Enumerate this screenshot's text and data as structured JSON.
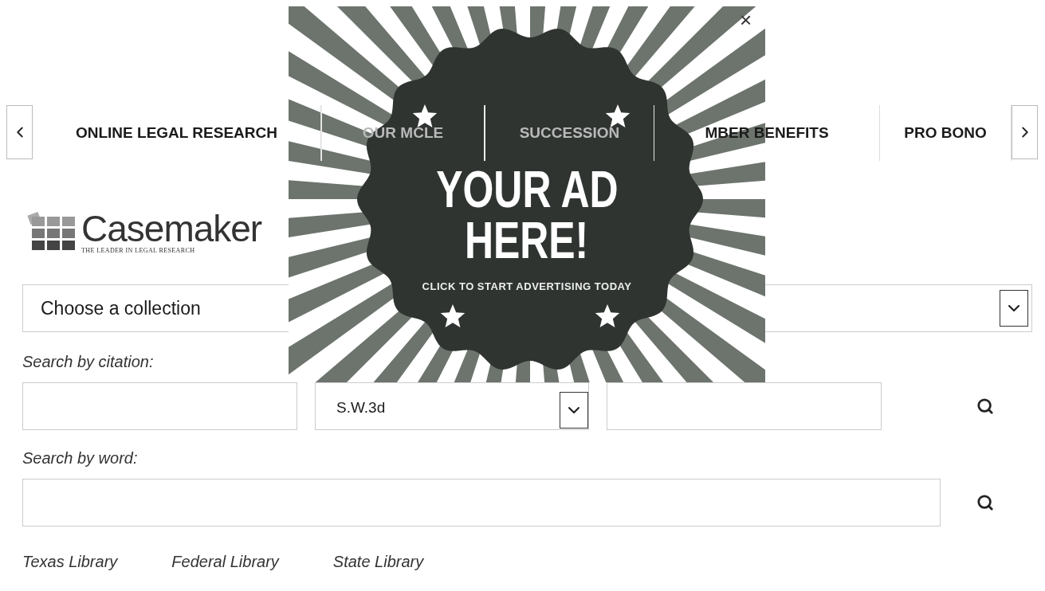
{
  "nav": {
    "tabs": [
      {
        "label": "ONLINE LEGAL RESEARCH",
        "dimmed": false
      },
      {
        "label": "OUR MCLE",
        "dimmed": true
      },
      {
        "label": "SUCCESSION",
        "dimmed": true
      },
      {
        "label": "MBER BENEFITS",
        "dimmed": false
      },
      {
        "label": "PRO BONO",
        "dimmed": false
      }
    ]
  },
  "logo": {
    "name": "Casemaker",
    "tagline": "THE LEADER IN LEGAL RESEARCH"
  },
  "collection_select": {
    "value": "Choose a collection"
  },
  "citation": {
    "label": "Search by citation:",
    "reporter": "S.W.3d"
  },
  "word_search": {
    "label": "Search by word:"
  },
  "libraries": [
    "Texas Library",
    "Federal Library",
    "State Library"
  ],
  "ad": {
    "headline": [
      "YOUR AD",
      "HERE!"
    ],
    "cta": "CLICK TO START ADVERTISING TODAY",
    "close": "×"
  }
}
